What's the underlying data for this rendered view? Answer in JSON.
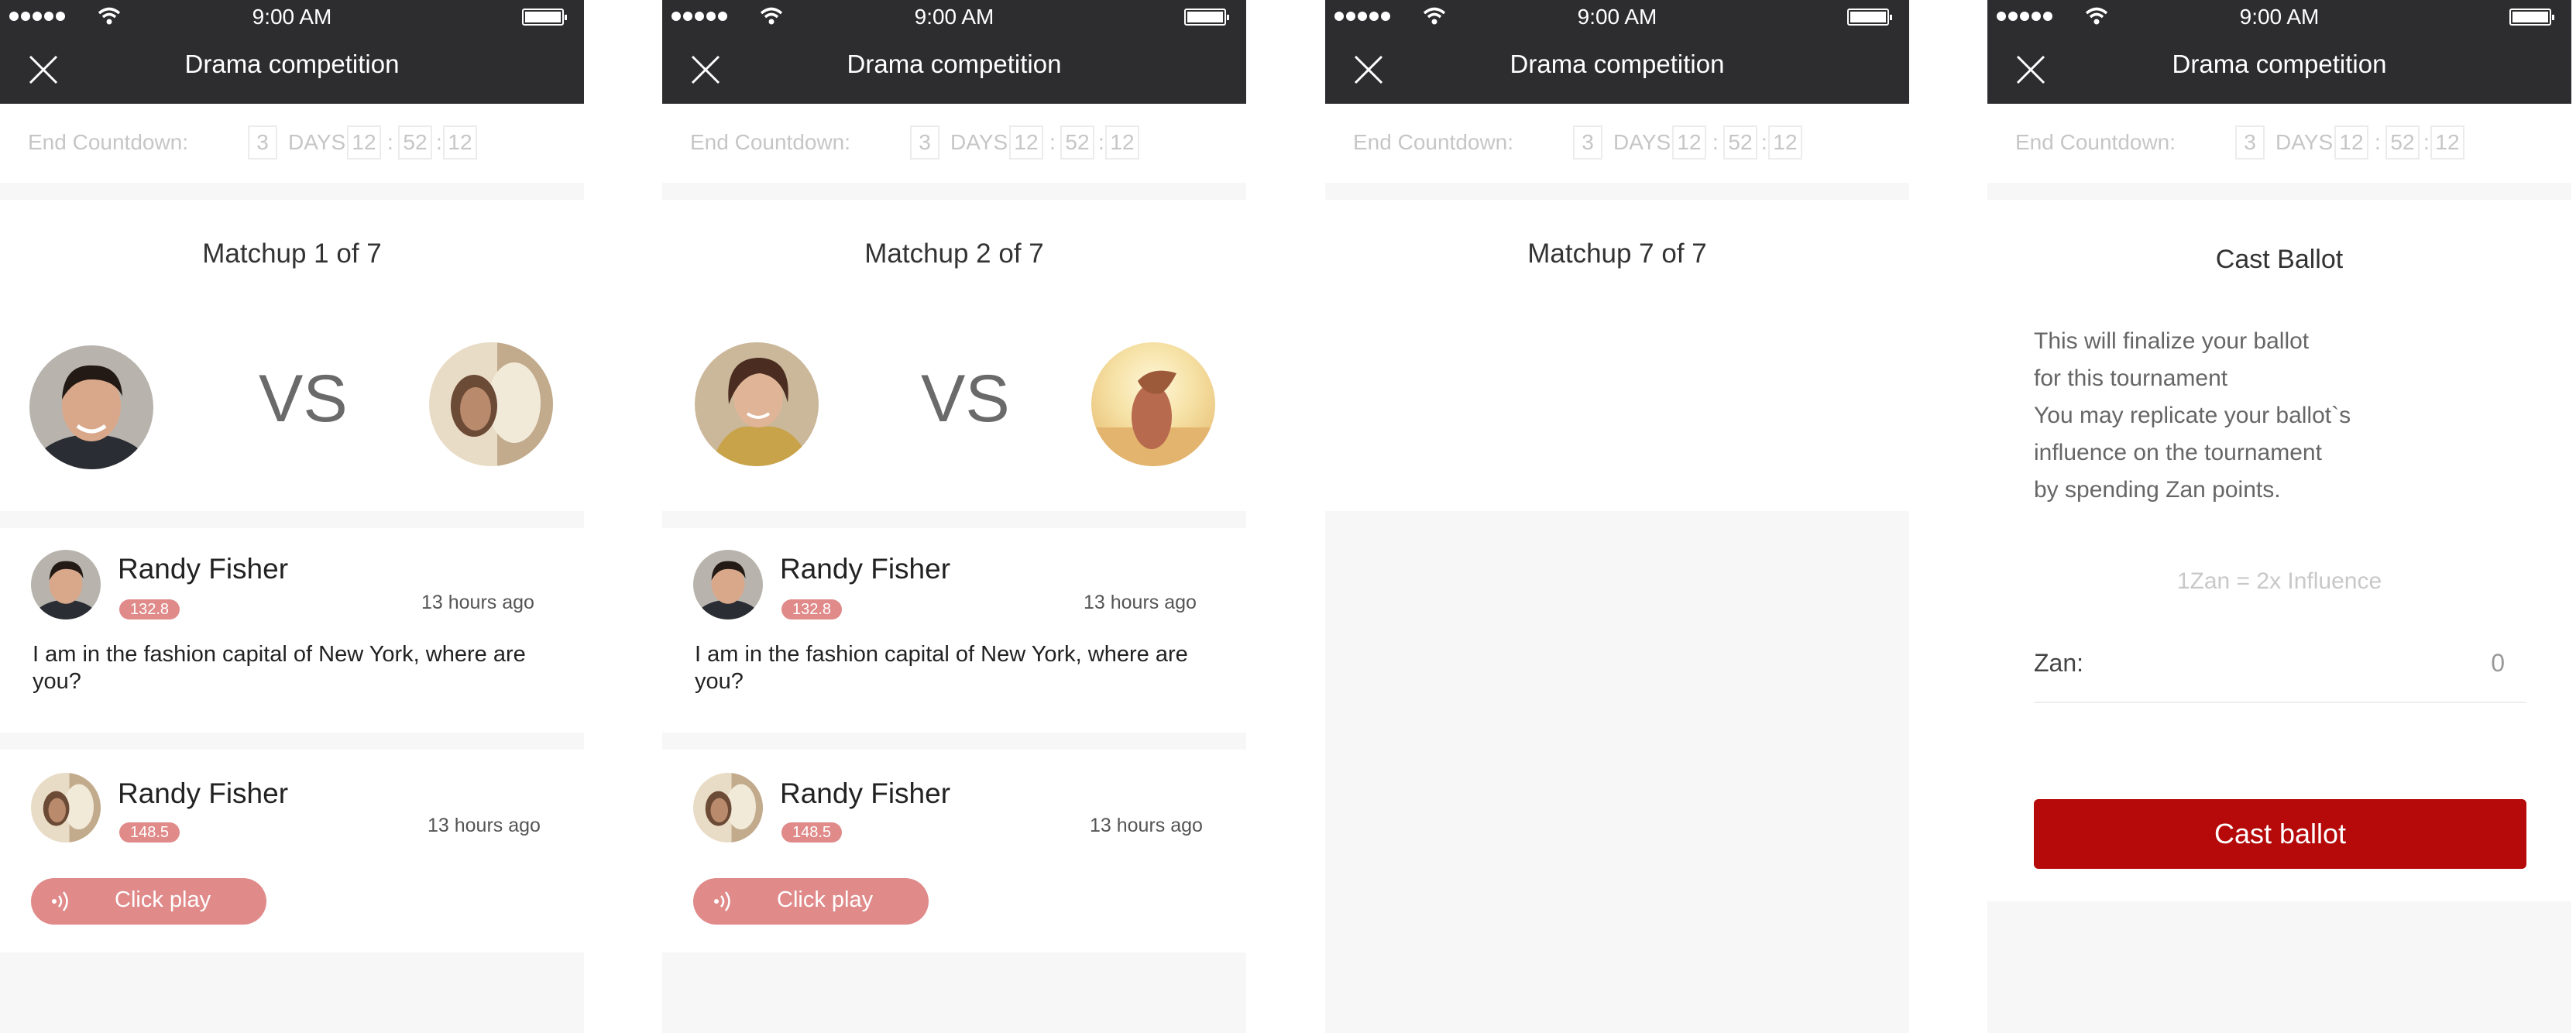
{
  "status_bar": {
    "time": "9:00 AM"
  },
  "header": {
    "title": "Drama competition"
  },
  "countdown": {
    "label": "End Countdown:",
    "days": "3",
    "days_label": "DAYS",
    "hours": "12",
    "minutes": "52",
    "seconds": "12"
  },
  "screen1": {
    "matchup": "Matchup 1 of 7",
    "vs": "VS",
    "comments": [
      {
        "name": "Randy Fisher",
        "score": "132.8",
        "time": "13 hours ago",
        "text": "I am in the fashion capital of New York, where are you?"
      },
      {
        "name": "Randy Fisher",
        "score": "148.5",
        "time": "13 hours ago",
        "play_label": "Click play"
      }
    ]
  },
  "screen2": {
    "matchup": "Matchup 2 of 7",
    "vs": "VS",
    "comments": [
      {
        "name": "Randy Fisher",
        "score": "132.8",
        "time": "13 hours ago",
        "text": "I am in the fashion capital of New York, where are you?"
      },
      {
        "name": "Randy Fisher",
        "score": "148.5",
        "time": "13 hours ago",
        "play_label": "Click play"
      }
    ]
  },
  "screen3": {
    "matchup": "Matchup 7 of 7"
  },
  "screen4": {
    "title": "Cast Ballot",
    "lines": [
      "This will finalize your ballot",
      "for this tournament",
      "You may replicate your ballot`s",
      "influence on the tournament",
      "by spending Zan points."
    ],
    "rate": "1Zan = 2x Influence",
    "zan_label": "Zan:",
    "zan_value": "0",
    "button": "Cast ballot"
  },
  "colors": {
    "header": "#2d2d2f",
    "badge": "#e08a8a",
    "accent": "#b60a0a",
    "background": "#f7f7f7"
  }
}
